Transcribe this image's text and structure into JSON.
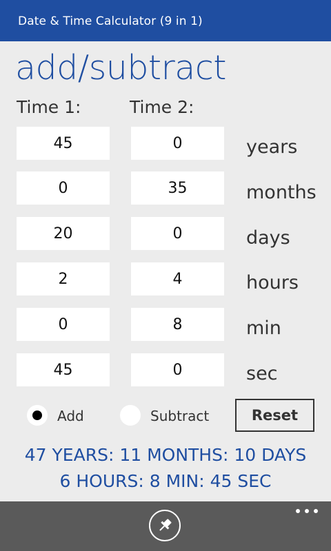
{
  "app": {
    "title": "Date & Time Calculator (9 in 1)"
  },
  "page": {
    "heading": "add/subtract"
  },
  "columns": {
    "time1": "Time 1:",
    "time2": "Time 2:"
  },
  "rows": [
    {
      "unit": "years",
      "time1": "45",
      "time2": "0"
    },
    {
      "unit": "months",
      "time1": "0",
      "time2": "35"
    },
    {
      "unit": "days",
      "time1": "20",
      "time2": "0"
    },
    {
      "unit": "hours",
      "time1": "2",
      "time2": "4"
    },
    {
      "unit": "min",
      "time1": "0",
      "time2": "8"
    },
    {
      "unit": "sec",
      "time1": "45",
      "time2": "0"
    }
  ],
  "operation": {
    "add_label": "Add",
    "subtract_label": "Subtract",
    "selected": "add"
  },
  "reset_label": "Reset",
  "result": {
    "line1": "47 YEARS: 11 MONTHS: 10 DAYS",
    "line2": "6 HOURS: 8 MIN: 45 SEC"
  },
  "appbar": {
    "icons": [
      "pin-icon",
      "more-icon"
    ]
  },
  "colors": {
    "accent": "#1f4ea1",
    "background": "#ececec",
    "appbar": "#5a5a5a"
  }
}
